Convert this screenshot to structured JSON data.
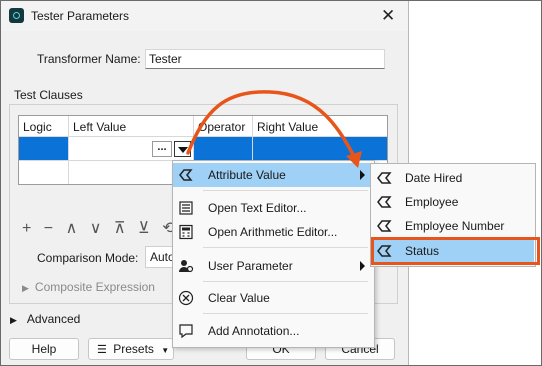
{
  "window": {
    "title": "Tester Parameters",
    "close_glyph": "✕"
  },
  "form": {
    "transformer_name_label": "Transformer Name:",
    "transformer_name_value": "Tester",
    "test_clauses_label": "Test Clauses",
    "comparison_mode_label": "Comparison Mode:",
    "comparison_mode_value": "Auto",
    "composite_label": "Composite Expression",
    "advanced_label": "Advanced"
  },
  "table": {
    "columns": [
      "Logic",
      "Left Value",
      "Operator",
      "Right Value"
    ],
    "ellipsis": "...",
    "selected_row": 0
  },
  "toolbar": {
    "glyphs": "+ − ∧ ∨ ⊼ ⊻ ⟲"
  },
  "buttons": {
    "help": "Help",
    "presets": "Presets",
    "ok": "OK",
    "cancel": "Cancel"
  },
  "menu": {
    "items": [
      {
        "label": "Attribute Value",
        "icon": "attribute-icon",
        "submenu": true,
        "highlighted": true
      },
      {
        "label": "Open Text Editor...",
        "icon": "text-editor-icon"
      },
      {
        "label": "Open Arithmetic Editor...",
        "icon": "calculator-icon"
      },
      {
        "label": "User Parameter",
        "icon": "user-parameter-icon",
        "submenu": true
      },
      {
        "label": "Clear Value",
        "icon": "clear-icon"
      },
      {
        "label": "Add Annotation...",
        "icon": "annotation-icon"
      }
    ]
  },
  "submenu": {
    "items": [
      {
        "label": "Date Hired"
      },
      {
        "label": "Employee"
      },
      {
        "label": "Employee Number"
      },
      {
        "label": "Status",
        "highlighted": true
      }
    ]
  },
  "colors": {
    "selection": "#0b72d7",
    "menu_highlight": "#9fd0f5",
    "callout": "#e8551a"
  }
}
